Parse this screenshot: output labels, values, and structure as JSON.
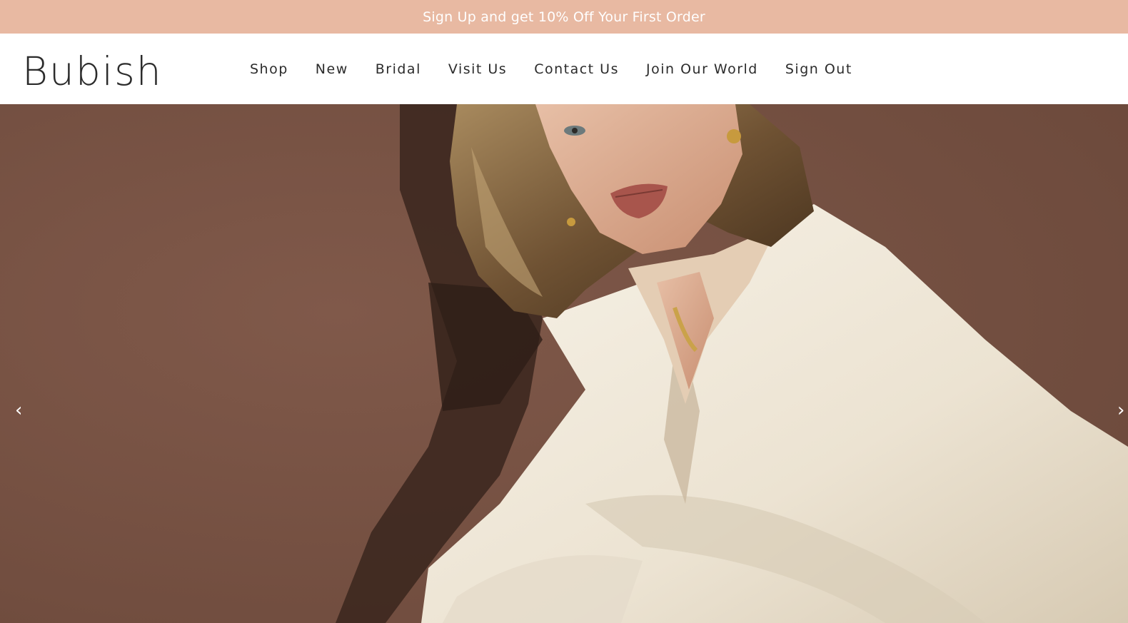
{
  "announcement": {
    "text": "Sign Up and get 10% Off Your First Order",
    "background": "#e8b9a2"
  },
  "header": {
    "logo": "Bubish",
    "nav": [
      {
        "label": "Shop"
      },
      {
        "label": "New"
      },
      {
        "label": "Bridal"
      },
      {
        "label": "Visit Us"
      },
      {
        "label": "Contact Us"
      },
      {
        "label": "Join Our World"
      },
      {
        "label": "Sign Out"
      }
    ]
  },
  "hero": {
    "prev_icon": "‹",
    "next_icon": "›"
  }
}
